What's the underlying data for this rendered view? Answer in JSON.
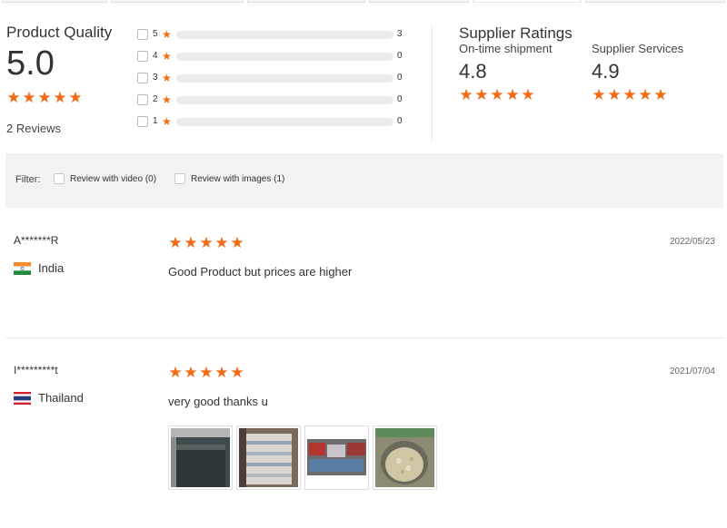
{
  "colors": {
    "accent": "#f26a11",
    "track": "#ececec",
    "filter_bg": "#f2f2f2"
  },
  "product_quality": {
    "title": "Product Quality",
    "score": "5.0",
    "stars": 5,
    "reviews_label": "2 Reviews"
  },
  "distribution": [
    {
      "level": "5",
      "count": "3",
      "fraction": 1.0
    },
    {
      "level": "4",
      "count": "0",
      "fraction": 0
    },
    {
      "level": "3",
      "count": "0",
      "fraction": 0
    },
    {
      "level": "2",
      "count": "0",
      "fraction": 0
    },
    {
      "level": "1",
      "count": "0",
      "fraction": 0
    }
  ],
  "supplier_ratings": {
    "title": "Supplier Ratings",
    "on_time": {
      "label": "On-time shipment",
      "value": "4.8",
      "stars": 5
    },
    "services": {
      "label": "Supplier Services",
      "value": "4.9",
      "stars": 5
    }
  },
  "filter": {
    "label": "Filter:",
    "video_option": "Review with video (0)",
    "images_option": "Review with images (1)"
  },
  "reviews": [
    {
      "user": "A*******R",
      "country": "India",
      "flag_icon": "india-flag-icon",
      "stars": 5,
      "date": "2022/05/23",
      "text": "Good Product but prices are higher"
    },
    {
      "user": "I*********t",
      "country": "Thailand",
      "flag_icon": "thailand-flag-icon",
      "stars": 5,
      "date": "2021/07/04",
      "text": "very good thanks u",
      "image_count": 4
    }
  ]
}
